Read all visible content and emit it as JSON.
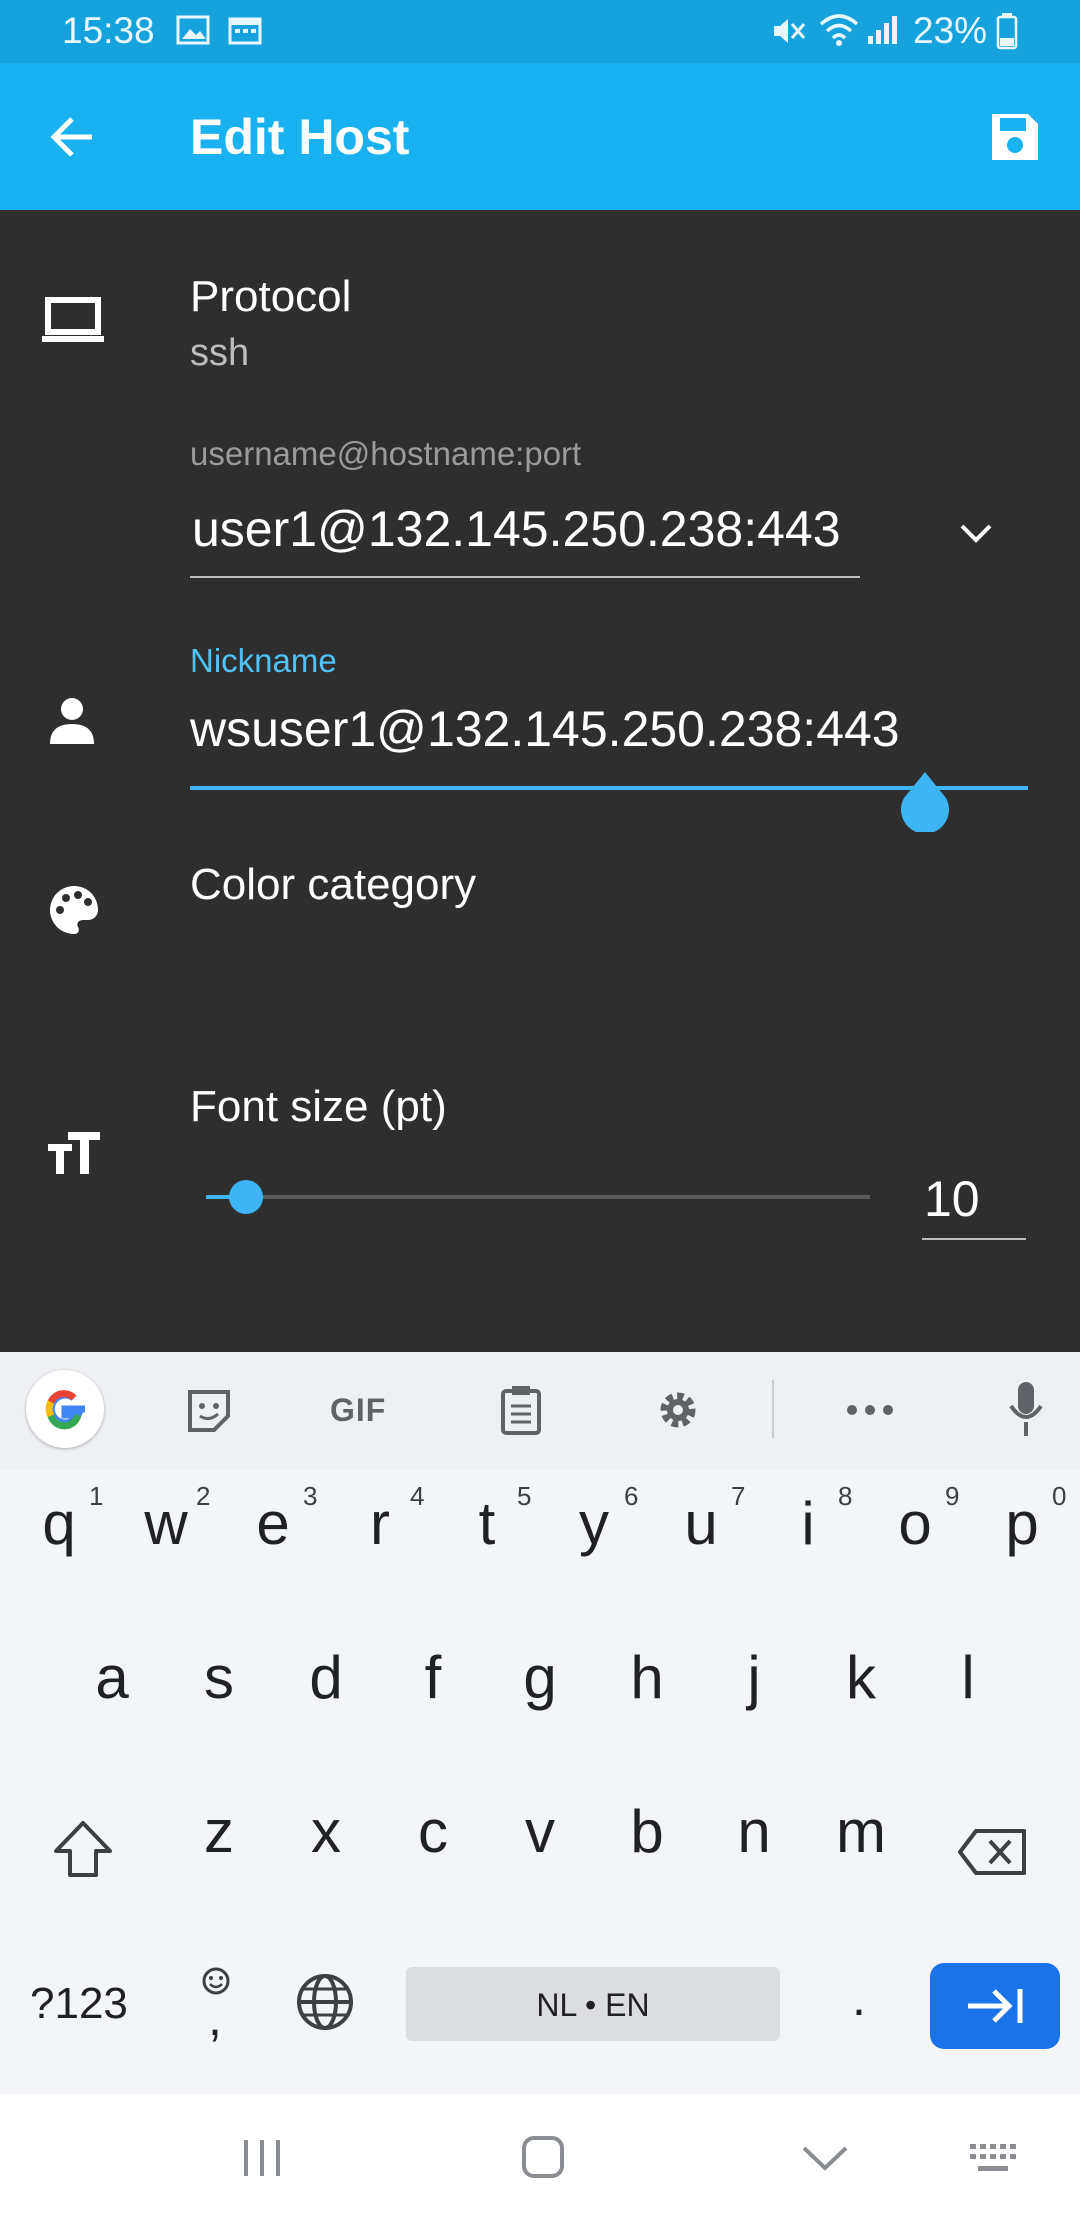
{
  "status_bar": {
    "time": "15:38",
    "battery": "23%"
  },
  "app_bar": {
    "title": "Edit Host"
  },
  "form": {
    "protocol_label": "Protocol",
    "protocol_value": "ssh",
    "address_hint": "username@hostname:port",
    "address_value": "user1@132.145.250.238:443",
    "nickname_label": "Nickname",
    "nickname_value": "wsuser1@132.145.250.238:443",
    "color_category_label": "Color category",
    "font_size_label": "Font size (pt)",
    "font_size_value": "10",
    "font_size_slider_fraction": 0.06
  },
  "keyboard": {
    "toolbar_gif": "GIF",
    "row1": [
      "q",
      "w",
      "e",
      "r",
      "t",
      "y",
      "u",
      "i",
      "o",
      "p"
    ],
    "row1_numbers": [
      "1",
      "2",
      "3",
      "4",
      "5",
      "6",
      "7",
      "8",
      "9",
      "0"
    ],
    "row2": [
      "a",
      "s",
      "d",
      "f",
      "g",
      "h",
      "j",
      "k",
      "l"
    ],
    "row3": [
      "z",
      "x",
      "c",
      "v",
      "b",
      "n",
      "m"
    ],
    "symbols_key": "?123",
    "comma_key": ",",
    "space_label": "NL • EN",
    "period_key": "."
  },
  "colors": {
    "accent": "#1ab1f0",
    "status": "#16a2dc",
    "content_bg": "#2e2e2f",
    "enter_key": "#1a73e8"
  }
}
